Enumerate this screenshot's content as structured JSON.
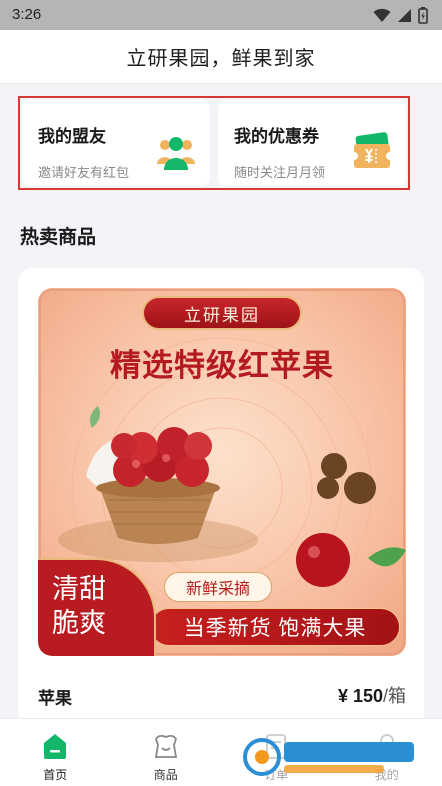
{
  "status_bar": {
    "time": "3:26"
  },
  "header": {
    "title": "立研果园，鲜果到家"
  },
  "cards": [
    {
      "title": "我的盟友",
      "subtitle": "邀请好友有红包",
      "icon": "friends-icon"
    },
    {
      "title": "我的优惠券",
      "subtitle": "随时关注月月领",
      "icon": "coupon-icon"
    }
  ],
  "section": {
    "title": "热卖商品"
  },
  "product": {
    "banner": {
      "brand": "立研果园",
      "headline": "精选特级红苹果",
      "tag": "新鲜采摘",
      "slogan": "当季新货 饱满大果",
      "badge_line1": "清甜",
      "badge_line2": "脆爽"
    },
    "name": "苹果",
    "price": "¥ 150",
    "unit": "/箱"
  },
  "tabs": [
    {
      "label": "首页",
      "icon": "home-icon",
      "active": true
    },
    {
      "label": "商品",
      "icon": "goods-icon",
      "active": false
    },
    {
      "label": "订单",
      "icon": "order-icon",
      "active": false
    },
    {
      "label": "我的",
      "icon": "profile-icon",
      "active": false
    }
  ],
  "colors": {
    "accent": "#12b76a",
    "brand_red": "#b31b20",
    "highlight_border": "#d43a33"
  }
}
